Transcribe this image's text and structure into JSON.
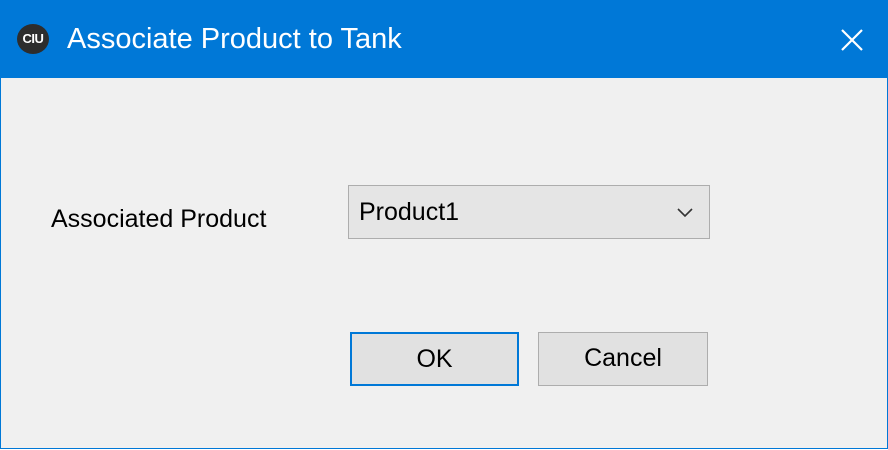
{
  "window": {
    "title": "Associate Product to Tank",
    "app_icon_text": "CIU",
    "close_icon": "close-icon",
    "accent_color": "#0078d7"
  },
  "form": {
    "associated_product_label": "Associated Product",
    "associated_product_value": "Product1",
    "dropdown_icon": "chevron-down-icon"
  },
  "buttons": {
    "ok_label": "OK",
    "cancel_label": "Cancel"
  }
}
